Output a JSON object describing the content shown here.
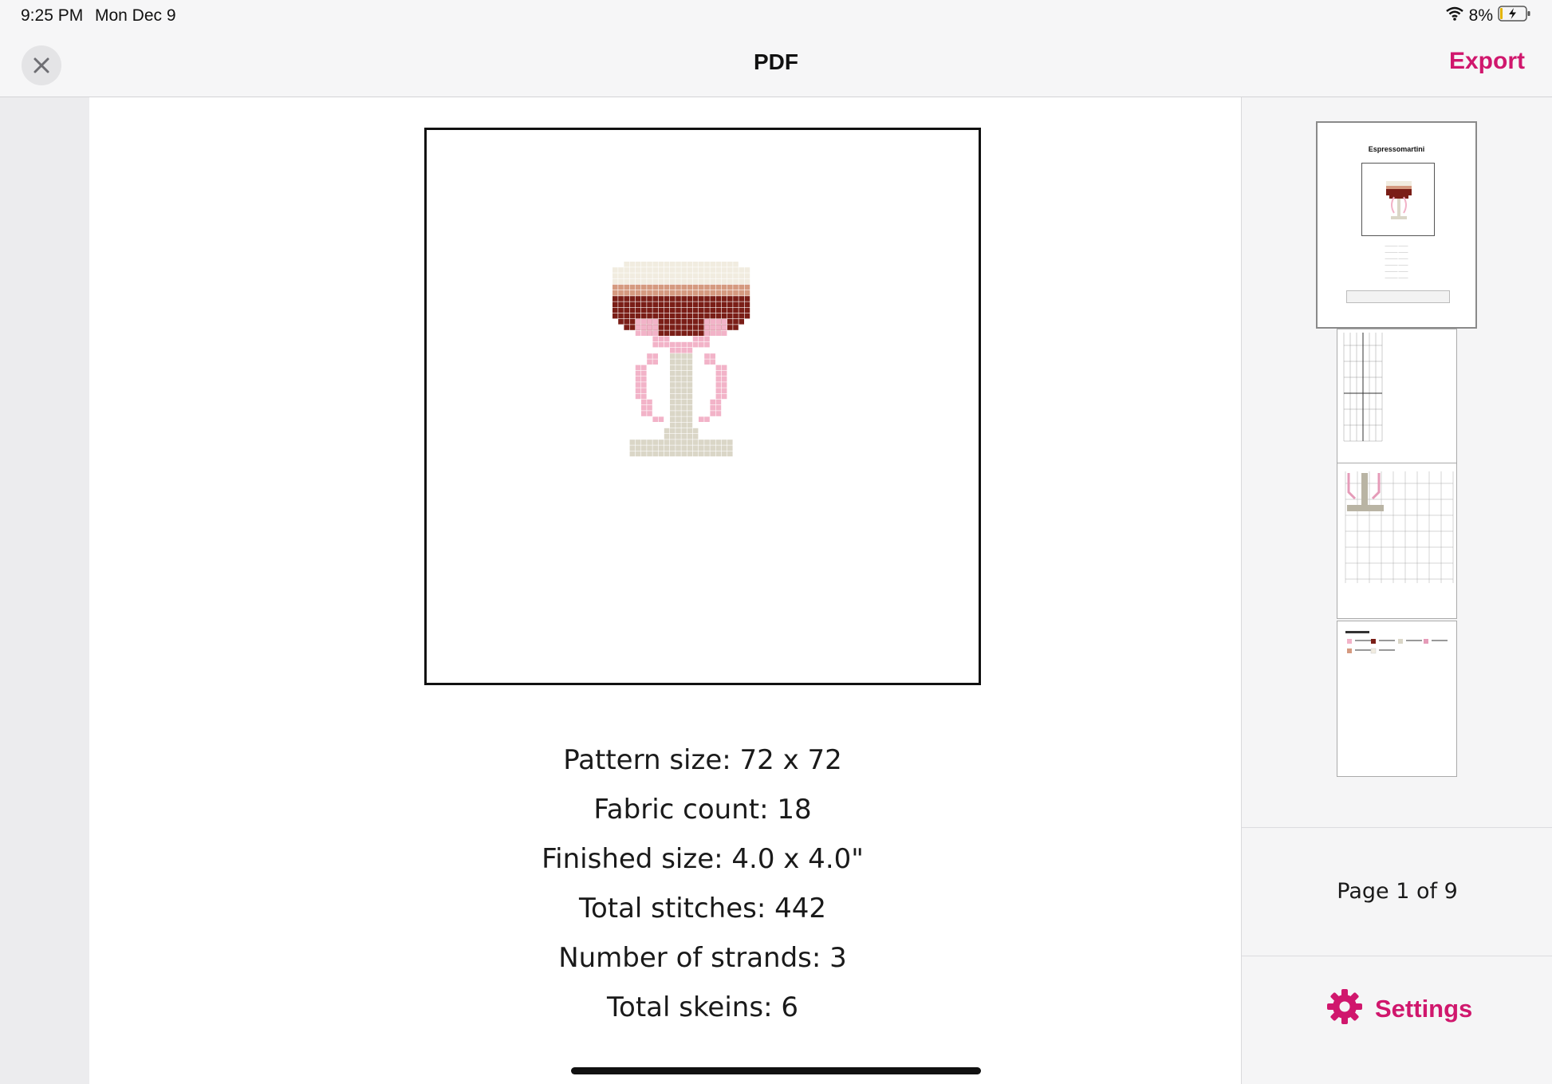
{
  "status_bar": {
    "time": "9:25 PM",
    "date": "Mon Dec 9",
    "battery": "8%"
  },
  "nav": {
    "title": "PDF",
    "export_label": "Export"
  },
  "document": {
    "specs": [
      "Pattern size: 72 x 72",
      "Fabric count: 18",
      "Finished size: 4.0 x 4.0\"",
      "Total stitches: 442",
      "Number of strands: 3",
      "Total skeins: 6"
    ]
  },
  "sidebar": {
    "thumbnail_title": "Espressomartini",
    "page_indicator": "Page 1 of 9",
    "settings_label": "Settings"
  },
  "colors": {
    "accent": "#d0176d",
    "cream": "#f1ece0",
    "foam_tan": "#d59a80",
    "coffee": "#7a1e17",
    "ribbon_pink": "#f2b3c8",
    "stem": "#dad6c7"
  }
}
